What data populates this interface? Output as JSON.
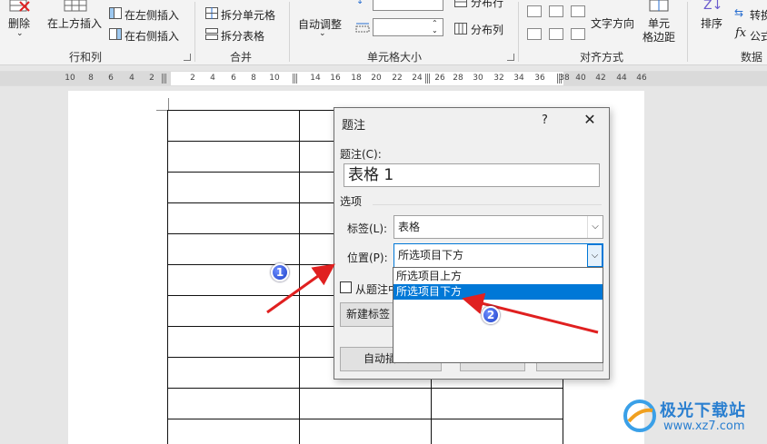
{
  "ribbon": {
    "delete_label": "删除",
    "insert_above_label": "在上方插入",
    "insert_left_label": "在左侧插入",
    "insert_right_label": "在右侧插入",
    "group_rows_cols": "行和列",
    "split_cells_label": "拆分单元格",
    "split_table_label": "拆分表格",
    "group_merge": "合并",
    "autofit_label": "自动调整",
    "distribute_rows_label": "分布行",
    "distribute_cols_label": "分布列",
    "group_cell_size": "单元格大小",
    "text_direction_label": "文字方向",
    "cell_margins_label_1": "单元",
    "cell_margins_label_2": "格边距",
    "group_alignment": "对齐方式",
    "sort_label": "排序",
    "convert_label": "转换",
    "formula_label": "公式",
    "group_data": "数据"
  },
  "ruler": {
    "left_numbers": [
      "10",
      "8",
      "6",
      "4",
      "2"
    ],
    "right_numbers": [
      "2",
      "4",
      "6",
      "8",
      "10",
      "12",
      "14",
      "16",
      "18",
      "20",
      "22",
      "24",
      "26",
      "28",
      "30",
      "32",
      "34",
      "36",
      "38",
      "40",
      "42",
      "44",
      "46"
    ]
  },
  "dialog": {
    "title": "题注",
    "help": "?",
    "close": "✕",
    "caption_label": "题注(C):",
    "caption_value": "表格  1",
    "options_label": "选项",
    "label_label": "标签(L):",
    "label_value": "表格",
    "position_label": "位置(P):",
    "position_value": "所选项目下方",
    "exclude_label_text": "从题注中",
    "new_label_button": "新建标签",
    "autoinsert_button": "自动插入题"
  },
  "dropdown": {
    "options": [
      "所选项目上方",
      "所选项目下方"
    ],
    "selected_index": 1
  },
  "annotations": {
    "step1": "1",
    "step2": "2"
  },
  "watermark": {
    "title": "极光下载站",
    "url": "www.xz7.com"
  }
}
